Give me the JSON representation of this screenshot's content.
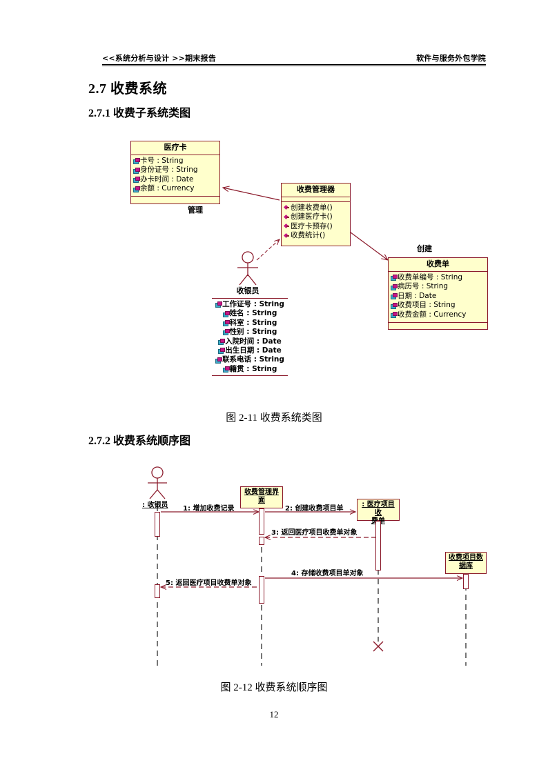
{
  "header": {
    "left": "<<系统分析与设计 >>期末报告",
    "right": "软件与服务外包学院"
  },
  "headings": {
    "section": "2.7 收费系统",
    "sub1": "2.7.1 收费子系统类图",
    "sub2": "2.7.2 收费系统顺序图"
  },
  "captions": {
    "figure1": "图 2-11 收费系统类图",
    "figure2": "图 2-12 收费系统顺序图"
  },
  "page_number": "12",
  "colors": {
    "box_fill": "#ffffcc",
    "box_border": "#8b1a2b",
    "line": "#8b1a2b",
    "attr_marker": "#3ba9c9",
    "op_marker": "#c71585"
  },
  "class_diagram": {
    "classes": [
      {
        "name": "医疗卡",
        "attributes": [
          "卡号 : String",
          "身份证号 : String",
          "办卡时间 : Date",
          "余额 : Currency"
        ],
        "operations": []
      },
      {
        "name": "收费管理器",
        "attributes": [],
        "operations": [
          "创建收费单()",
          "创建医疗卡()",
          "医疗卡预存()",
          "收费统计()"
        ]
      },
      {
        "name": "收费单",
        "attributes": [
          "收费单编号 : String",
          "病历号 : String",
          "日期 : Date",
          "收费项目 : String",
          "收费金额 : Currency"
        ],
        "operations": []
      }
    ],
    "actor": {
      "name": "收银员",
      "attributes": [
        "工作证号 : String",
        "姓名 : String",
        "科室 : String",
        "性别 : String",
        "入院时间 : Date",
        "出生日期 : Date",
        "联系电话 : String",
        "籍贯 : String"
      ]
    },
    "relationship_labels": [
      {
        "text": "管理"
      },
      {
        "text": "创建"
      }
    ]
  },
  "sequence_diagram": {
    "actor_label": ": 收银员",
    "lifelines": [
      {
        "line1": "收费管理界",
        "line2": "面"
      },
      {
        "line1": ": 医疗项目收",
        "line2": "费单"
      },
      {
        "line1": "收费项目数",
        "line2": "据库"
      }
    ],
    "messages": [
      "1: 增加收费记录",
      "2: 创建收费项目单",
      "3: 返回医疗项目收费单对象",
      "4: 存储收费项目单对象",
      "5: 返回医疗项目收费单对象"
    ]
  }
}
